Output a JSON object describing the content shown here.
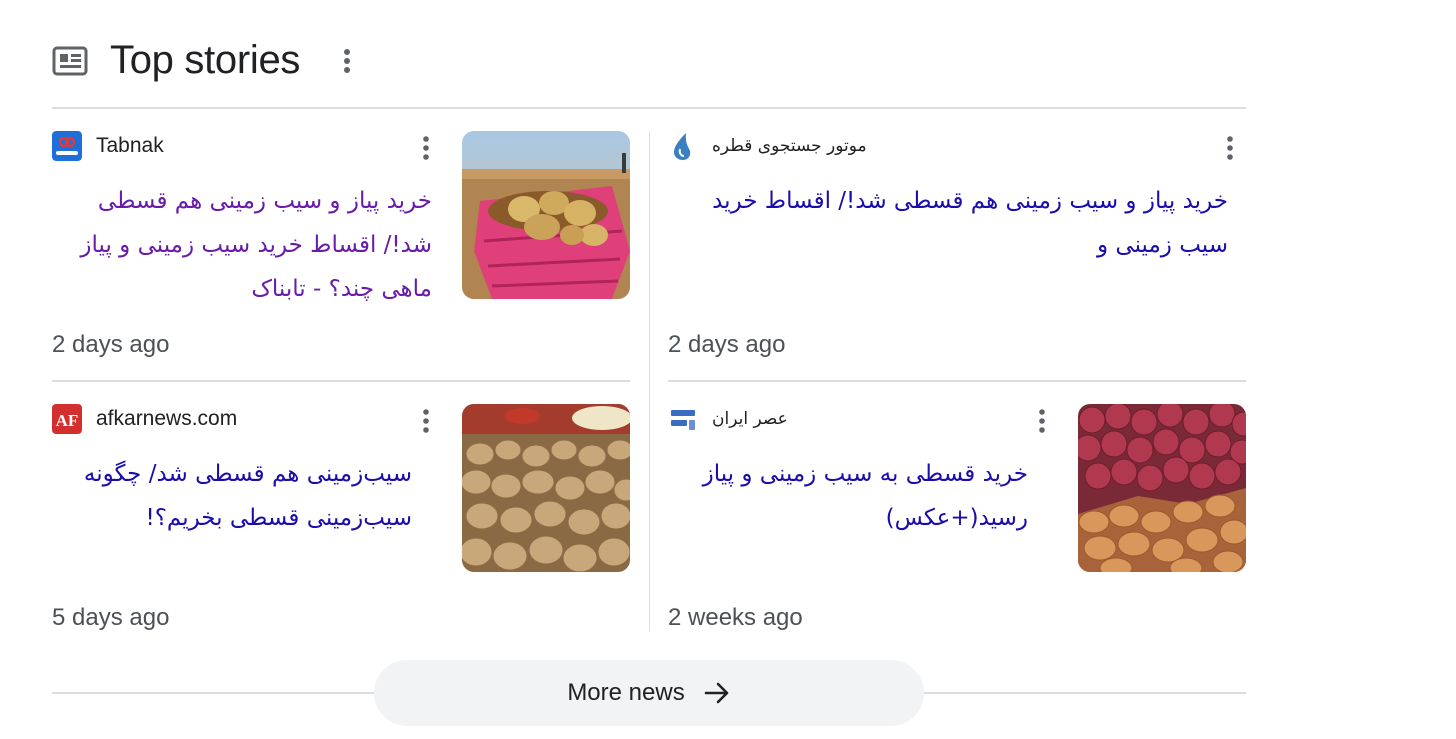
{
  "header": {
    "title": "Top stories",
    "icon": "newspaper-icon",
    "menu_icon": "kebab-menu-icon"
  },
  "stories": [
    {
      "source": "Tabnak",
      "favicon": "tabnak-favicon",
      "headline": "خرید پیاز و سیب زمینی هم قسطی شد!/ اقساط خرید سیب زمینی و پیاز ماهی چند؟ - تابناک",
      "time": "2 days ago",
      "visited": true,
      "thumbnail": "potato-sack-field-image"
    },
    {
      "source": "موتور جستجوی قطره",
      "favicon": "ghatreh-drop-favicon",
      "headline": "خرید پیاز و سیب زمینی هم قسطی شد!/ اقساط خرید سیب زمینی و",
      "time": "2 days ago",
      "visited": false
    },
    {
      "source": "afkarnews.com",
      "favicon": "afkarnews-favicon",
      "favicon_text": "AF",
      "headline": "سیب‌زمینی هم قسطی شد/ چگونه سیب‌زمینی قسطی بخریم؟!",
      "time": "5 days ago",
      "visited": false,
      "thumbnail": "potato-pile-image"
    },
    {
      "source": "عصر ایران",
      "favicon": "asriran-favicon",
      "headline": "خرید قسطی به سیب زمینی و پیاز رسید(+عکس)",
      "time": "2 weeks ago",
      "visited": false,
      "thumbnail": "onions-potatoes-image"
    }
  ],
  "more_news": {
    "label": "More news",
    "icon": "arrow-right-icon"
  },
  "colors": {
    "visited_link": "#681da8",
    "link": "#1a0dab",
    "meta_text": "#4d5156",
    "divider": "#dadce0",
    "button_bg": "#f1f3f4"
  }
}
